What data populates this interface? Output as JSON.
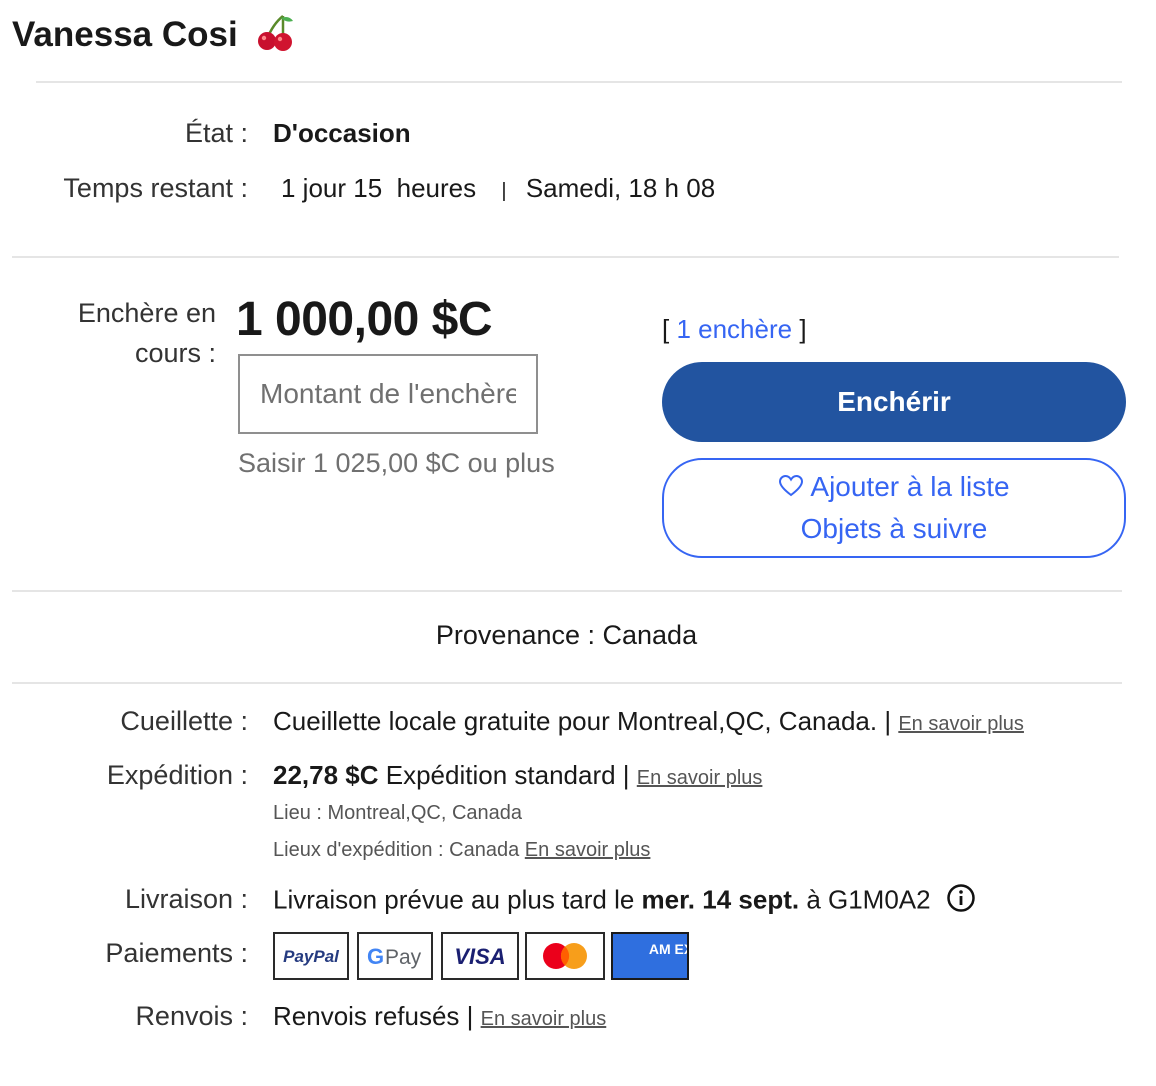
{
  "seller": {
    "name": "Vanessa Cosi",
    "emoji_icon": "cherry-icon"
  },
  "condition": {
    "label": "État :",
    "value": "D'occasion"
  },
  "time_left": {
    "label": "Temps restant :",
    "value": "1 jour 15  heures",
    "separator": "|",
    "end": "Samedi, 18 h 08"
  },
  "bid": {
    "label_line1": "Enchère en",
    "label_line2": "cours :",
    "current_price": "1 000,00 $C",
    "input_placeholder": "Montant de l'enchère",
    "hint": "Saisir 1 025,00 $C ou plus",
    "count_open": "[ ",
    "count_link": "1 enchère",
    "count_close": " ]",
    "bid_button": "Enchérir",
    "watch_line1": "Ajouter à la liste",
    "watch_line2": "Objets à suivre"
  },
  "origin": {
    "text": "Provenance : Canada"
  },
  "pickup": {
    "label": "Cueillette :",
    "value": "Cueillette locale gratuite pour Montreal,QC, Canada.",
    "sep": " | ",
    "link": "En savoir plus"
  },
  "shipping": {
    "label": "Expédition :",
    "price": "22,78 $C",
    "method": " Expédition standard",
    "sep": " | ",
    "link": "En savoir plus",
    "location": "Lieu : Montreal,QC, Canada",
    "ship_to": "Lieux d'expédition : Canada",
    "ship_to_link": "En savoir plus"
  },
  "delivery": {
    "label": "Livraison :",
    "prefix": "Livraison prévue au plus tard le ",
    "date": "mer. 14 sept.",
    "suffix": " à G1M0A2"
  },
  "payments": {
    "label": "Paiements :",
    "paypal": "PayPal",
    "gpay_g": "G",
    "gpay_pay": "Pay",
    "visa": "VISA",
    "amex": "AM EX"
  },
  "returns": {
    "label": "Renvois :",
    "value": "Renvois refusés",
    "sep": " | ",
    "link": "En savoir plus"
  },
  "colors": {
    "primary_button": "#2254a0",
    "link_blue": "#3665f3",
    "divider": "#e5e5e5"
  }
}
